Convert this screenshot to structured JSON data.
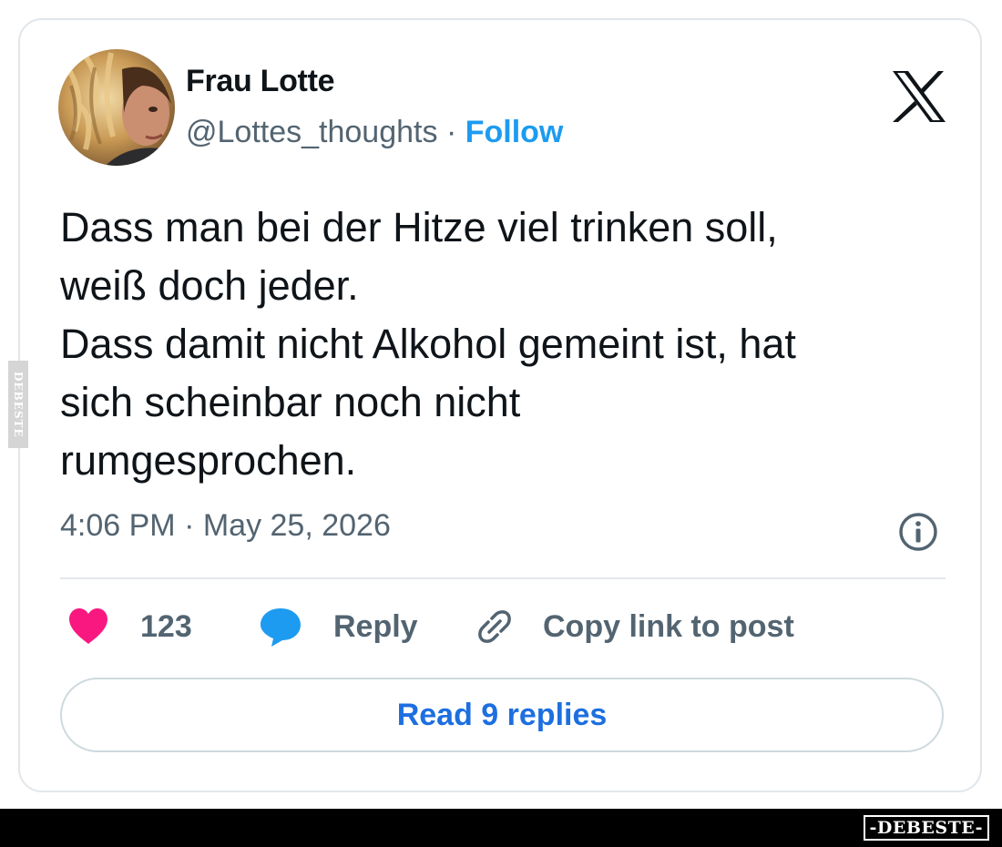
{
  "tweet": {
    "author_name": "Frau Lotte",
    "handle": "@Lottes_thoughts",
    "separator": "·",
    "follow_label": "Follow",
    "text_lines": [
      "Dass man bei der Hitze viel trinken soll,",
      "weiß doch jeder.",
      "Dass damit nicht Alkohol gemeint ist, hat",
      "sich scheinbar noch nicht",
      "rumgesprochen."
    ],
    "timestamp": "4:06 PM · May 25, 2026"
  },
  "actions": {
    "like_count": "123",
    "reply_label": "Reply",
    "copy_label": "Copy link to post"
  },
  "read_replies_label": "Read 9 replies",
  "icons": {
    "platform": "x-logo-icon",
    "info": "info-icon",
    "like": "heart-icon",
    "reply": "speech-bubble-icon",
    "copy": "link-icon"
  },
  "colors": {
    "accent": "#1d9bf0",
    "like": "#f91880",
    "text_secondary": "#536471"
  },
  "watermark": {
    "side": "DEBESTE",
    "badge": "-DEBESTE-"
  }
}
